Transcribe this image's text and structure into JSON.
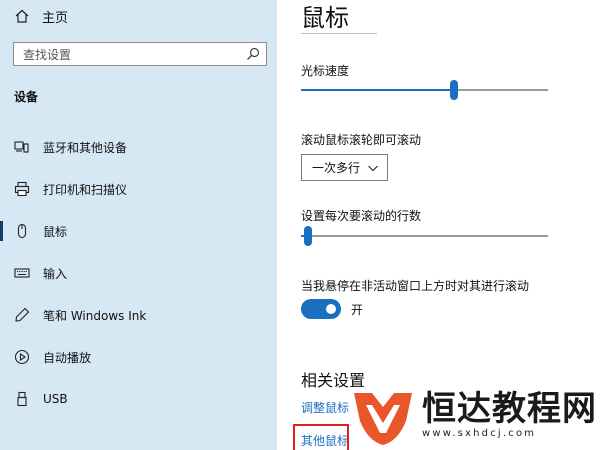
{
  "sidebar": {
    "home_label": "主页",
    "search": {
      "placeholder": "查找设置"
    },
    "section_label": "设备",
    "items": [
      {
        "label": "蓝牙和其他设备",
        "icon": "bluetooth-device-icon"
      },
      {
        "label": "打印机和扫描仪",
        "icon": "printer-icon"
      },
      {
        "label": "鼠标",
        "icon": "mouse-icon",
        "active": true
      },
      {
        "label": "输入",
        "icon": "keyboard-icon"
      },
      {
        "label": "笔和 Windows Ink",
        "icon": "pen-icon"
      },
      {
        "label": "自动播放",
        "icon": "autoplay-icon"
      },
      {
        "label": "USB",
        "icon": "usb-icon"
      }
    ]
  },
  "main": {
    "title": "鼠标",
    "cursor_speed": {
      "label": "光标速度",
      "value_fraction": 0.62
    },
    "scroll_mode": {
      "label": "滚动鼠标滚轮即可滚动",
      "selected": "一次多行"
    },
    "lines_to_scroll": {
      "label": "设置每次要滚动的行数",
      "value_fraction": 0.03
    },
    "inactive_scroll": {
      "label": "当我悬停在非活动窗口上方时对其进行滚动",
      "state": "开",
      "on": true
    },
    "related": {
      "title": "相关设置",
      "links": [
        "调整鼠标",
        "其他鼠标"
      ]
    }
  },
  "colors": {
    "sidebar_bg": "#d6e8f3",
    "accent": "#1b6ec2",
    "highlight": "#e02020",
    "logo": "#e8562a"
  },
  "watermark": {
    "brand": "恒达教程网",
    "site": "www.sxhdcj.com"
  }
}
